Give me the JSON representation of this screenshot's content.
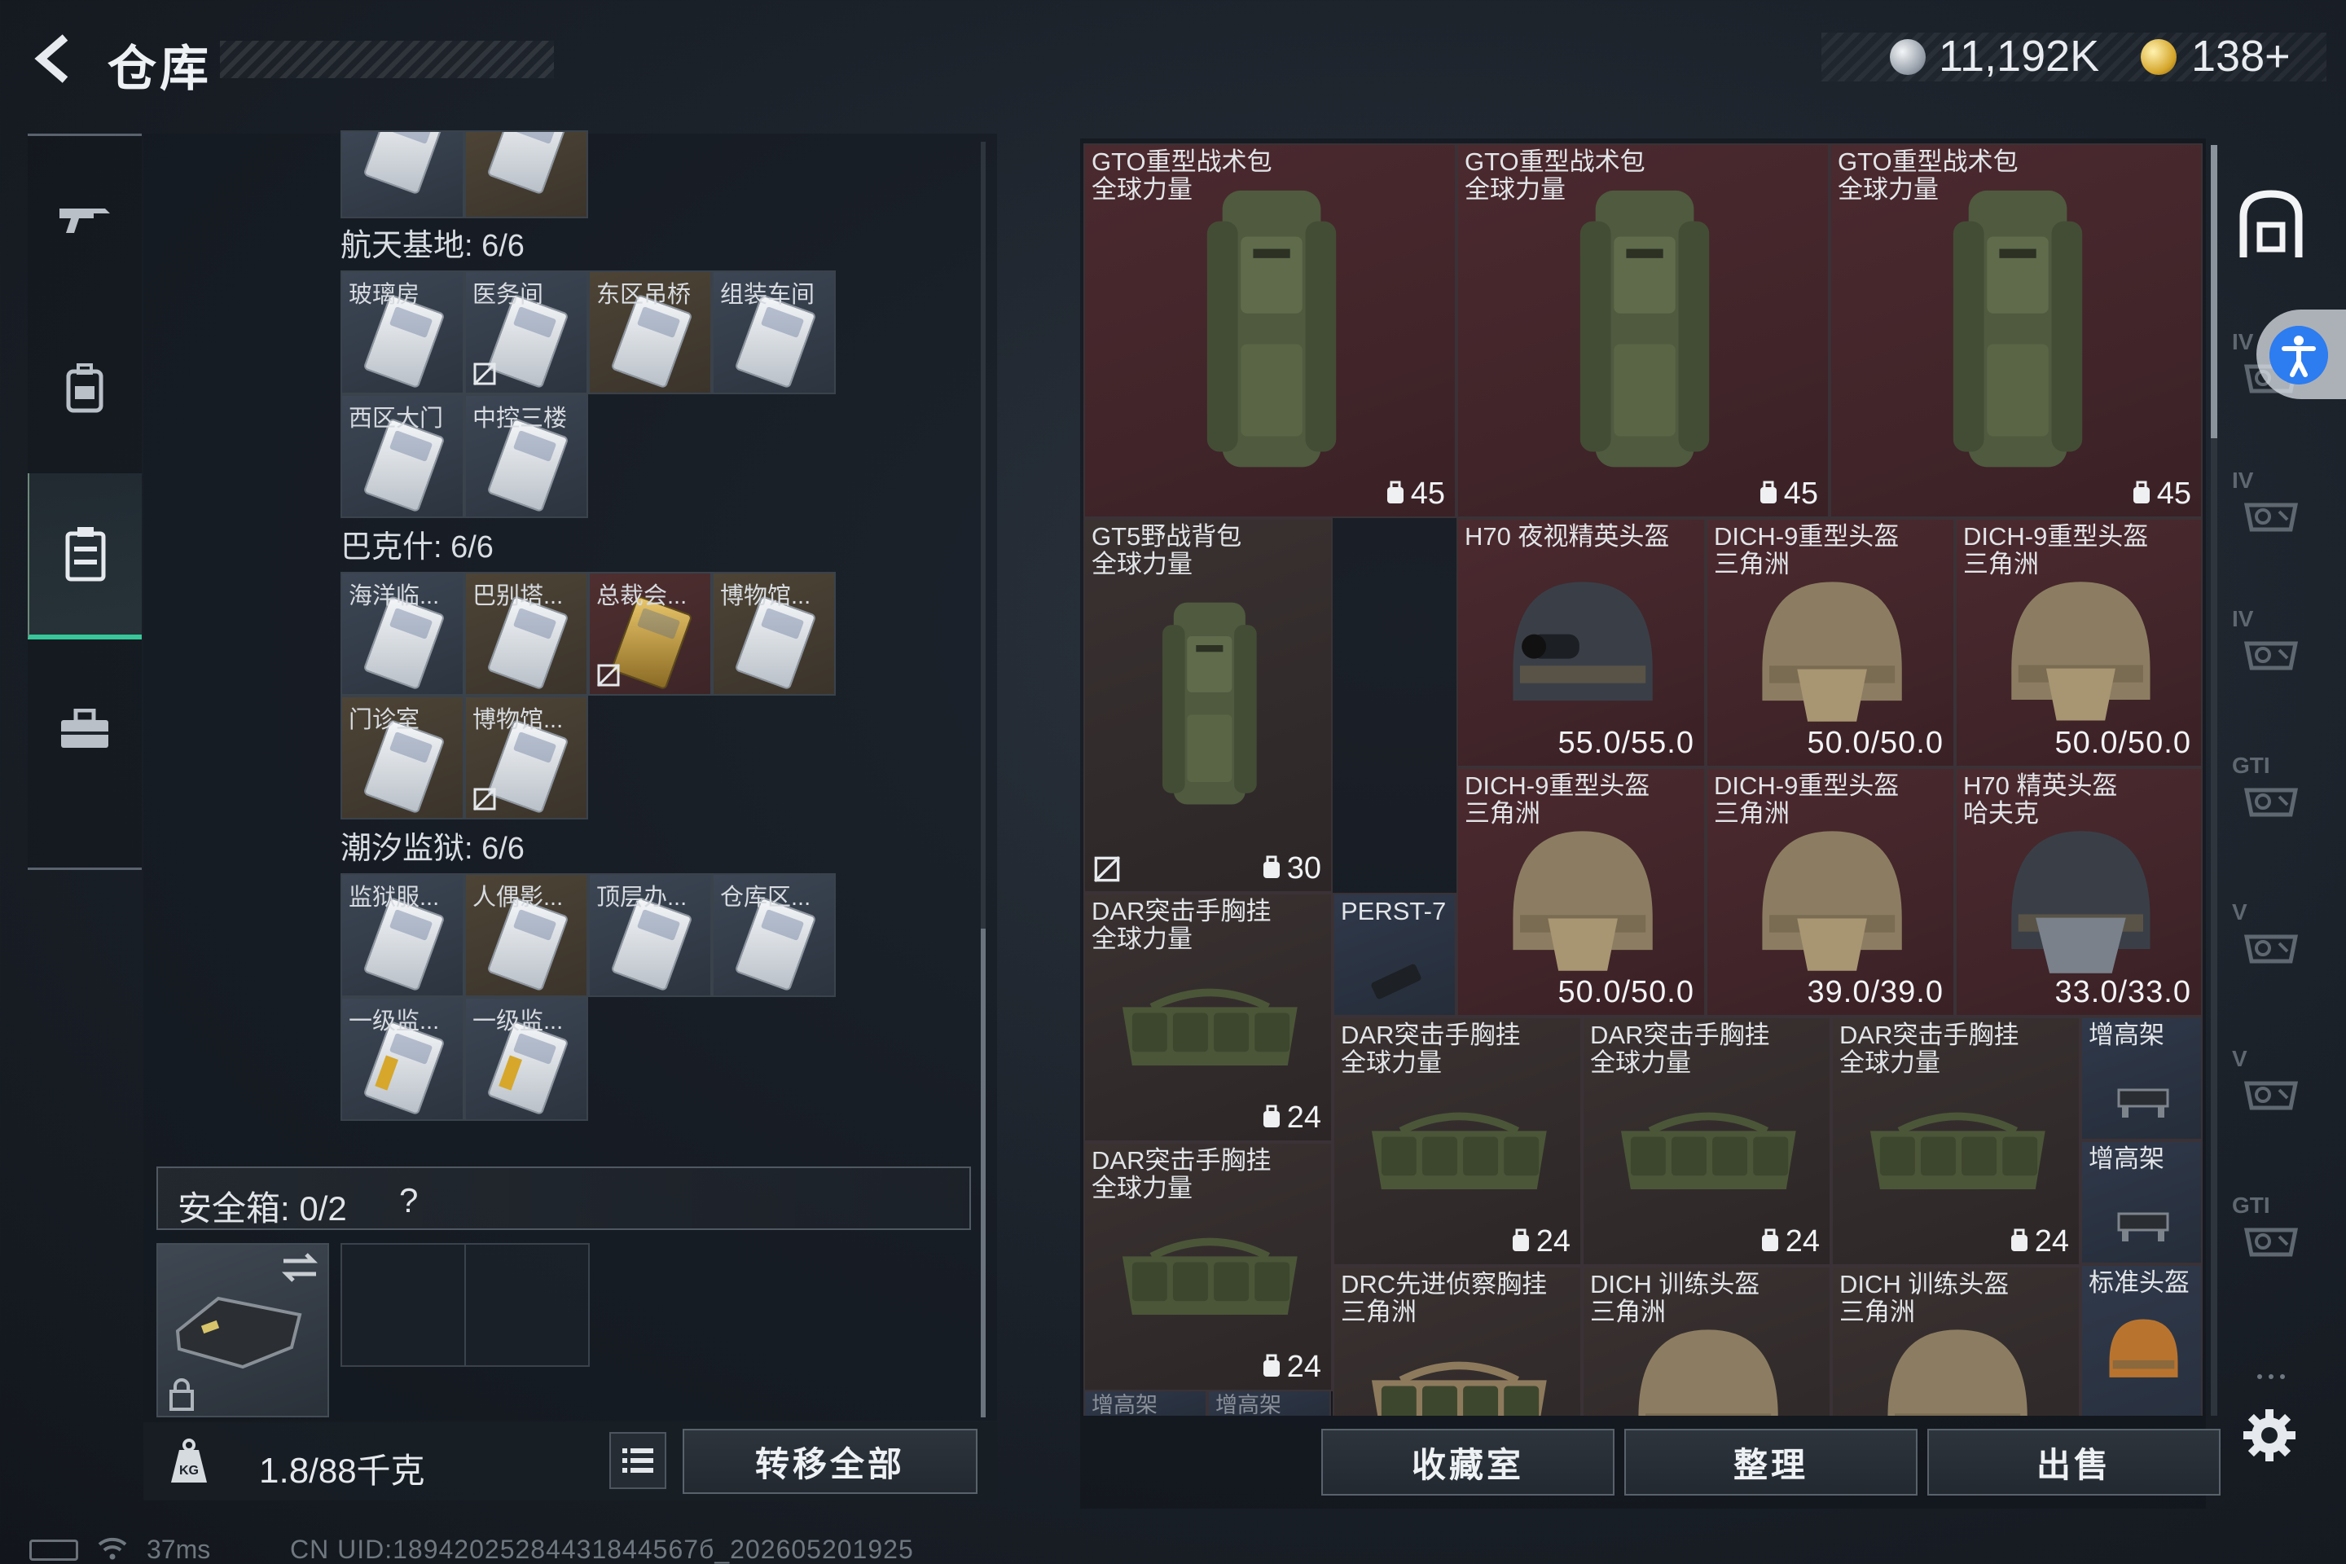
{
  "header": {
    "title": "仓库",
    "currency": "11,192K",
    "premium": "138+"
  },
  "left_nav": {
    "items": [
      {
        "name": "weapons",
        "icon": "rifle-icon"
      },
      {
        "name": "equipment",
        "icon": "backpack-icon"
      },
      {
        "name": "keys",
        "icon": "card-holder-icon",
        "active": true
      },
      {
        "name": "supplies",
        "icon": "toolbox-icon"
      }
    ]
  },
  "key_sections": [
    {
      "header": "航天基地: 6/6",
      "keys": [
        {
          "label": "玻璃房",
          "color": "gray",
          "nosell": false
        },
        {
          "label": "医务间",
          "color": "gray",
          "nosell": true
        },
        {
          "label": "东区吊桥",
          "color": "brown",
          "nosell": false
        },
        {
          "label": "组装车间",
          "color": "gray",
          "nosell": false
        },
        {
          "label": "西区大门",
          "color": "gray",
          "nosell": false
        },
        {
          "label": "中控三楼",
          "color": "gray",
          "nosell": false
        }
      ]
    },
    {
      "header": "巴克什: 6/6",
      "keys": [
        {
          "label": "海洋临...",
          "color": "gray",
          "nosell": false
        },
        {
          "label": "巴别塔...",
          "color": "brown",
          "nosell": false
        },
        {
          "label": "总裁会...",
          "color": "red",
          "nosell": true,
          "gold": true
        },
        {
          "label": "博物馆...",
          "color": "brown",
          "nosell": false
        },
        {
          "label": "门诊室",
          "color": "brown",
          "nosell": false
        },
        {
          "label": "博物馆...",
          "color": "brown",
          "nosell": true
        }
      ]
    },
    {
      "header": "潮汐监狱: 6/6",
      "keys": [
        {
          "label": "监狱服...",
          "color": "gray",
          "nosell": false
        },
        {
          "label": "人偶影...",
          "color": "brown",
          "nosell": false
        },
        {
          "label": "顶层办...",
          "color": "gray",
          "nosell": false
        },
        {
          "label": "仓库区...",
          "color": "gray",
          "nosell": false
        },
        {
          "label": "一级监...",
          "color": "gray",
          "nosell": false,
          "tab": true
        },
        {
          "label": "一级监...",
          "color": "gray",
          "nosell": false,
          "tab": true
        }
      ]
    }
  ],
  "safebox": {
    "label": "安全箱:",
    "count": "0/2",
    "help": "?"
  },
  "weight": {
    "current": "1.8",
    "max": "/88千克"
  },
  "buttons": {
    "transfer_all": "转移全部",
    "collection": "收藏室",
    "organize": "整理",
    "sell": "出售"
  },
  "stash_items": [
    {
      "name": "GTO重型战术包\n全球力量",
      "type": "backpack",
      "cap": "45",
      "color": "r",
      "nosell": false
    },
    {
      "name": "GTO重型战术包\n全球力量",
      "type": "backpack",
      "cap": "45",
      "color": "r",
      "nosell": false
    },
    {
      "name": "GTO重型战术包\n全球力量",
      "type": "backpack",
      "cap": "45",
      "color": "r",
      "nosell": false
    },
    {
      "name": "GT5野战背包\n全球力量",
      "type": "backpack",
      "cap": "30",
      "color": "d",
      "nosell": true
    },
    {
      "name": "H70 夜视精英头盔",
      "type": "nvg-helmet",
      "dur": "55.0/55.0",
      "color": "r"
    },
    {
      "name": "DICH-9重型头盔\n三角洲",
      "type": "helmet",
      "dur": "50.0/50.0",
      "color": "r"
    },
    {
      "name": "DICH-9重型头盔\n三角洲",
      "type": "helmet",
      "dur": "50.0/50.0",
      "color": "r"
    },
    {
      "name": "DICH-9重型头盔\n三角洲",
      "type": "helmet",
      "dur": "50.0/50.0",
      "color": "r"
    },
    {
      "name": "DICH-9重型头盔\n三角洲",
      "type": "helmet",
      "dur": "39.0/39.0",
      "color": "r"
    },
    {
      "name": "H70 精英头盔\n哈夫克",
      "type": "mask-helmet",
      "dur": "33.0/33.0",
      "color": "r"
    },
    {
      "name": "DAR突击手胸挂\n全球力量",
      "type": "rig",
      "cap": "24",
      "color": "d"
    },
    {
      "name": "PERST-7",
      "type": "device",
      "color": "b"
    },
    {
      "name": "DAR突击手胸挂\n全球力量",
      "type": "rig",
      "cap": "24",
      "color": "d"
    },
    {
      "name": "DAR突击手胸挂\n全球力量",
      "type": "rig",
      "cap": "24",
      "color": "d"
    },
    {
      "name": "DAR突击手胸挂\n全球力量",
      "type": "rig",
      "cap": "24",
      "color": "d"
    },
    {
      "name": "增高架",
      "type": "riser",
      "color": "b"
    },
    {
      "name": "DAR突击手胸挂\n全球力量",
      "type": "rig",
      "cap": "24",
      "color": "d"
    },
    {
      "name": "增高架",
      "type": "riser",
      "color": "b"
    },
    {
      "name": "DRC先进侦察胸挂\n三角洲",
      "type": "rig-tan",
      "color": "d"
    },
    {
      "name": "DICH 训练头盔\n三角洲",
      "type": "helmet",
      "color": "d"
    },
    {
      "name": "DICH 训练头盔\n三角洲",
      "type": "helmet",
      "color": "d"
    },
    {
      "name": "标准头盔",
      "type": "small-helmet",
      "color": "b"
    },
    {
      "name": "增高架",
      "type": "riser-label",
      "color": "b"
    },
    {
      "name": "增高架",
      "type": "riser-label",
      "color": "b"
    }
  ],
  "right_rail": {
    "icons": [
      "vault-icon",
      "armor-iv-icon",
      "armor-iv-icon",
      "armor-iv-icon",
      "armor-gti-icon",
      "armor-v-icon",
      "armor-v-icon",
      "armor-gti-icon",
      "more-icon"
    ],
    "labels": [
      "",
      "IV",
      "IV",
      "IV",
      "GTI",
      "V",
      "V",
      "GTI",
      "..."
    ]
  },
  "status": {
    "ping": "37ms",
    "uid": "CN UID:18942025284431844567б_202605201925"
  },
  "colors": {
    "accent_green": "#38c79a",
    "rare_red": "#4b2a2f",
    "epic_gold": "#4d4436",
    "common_gray": "#3c4654"
  }
}
